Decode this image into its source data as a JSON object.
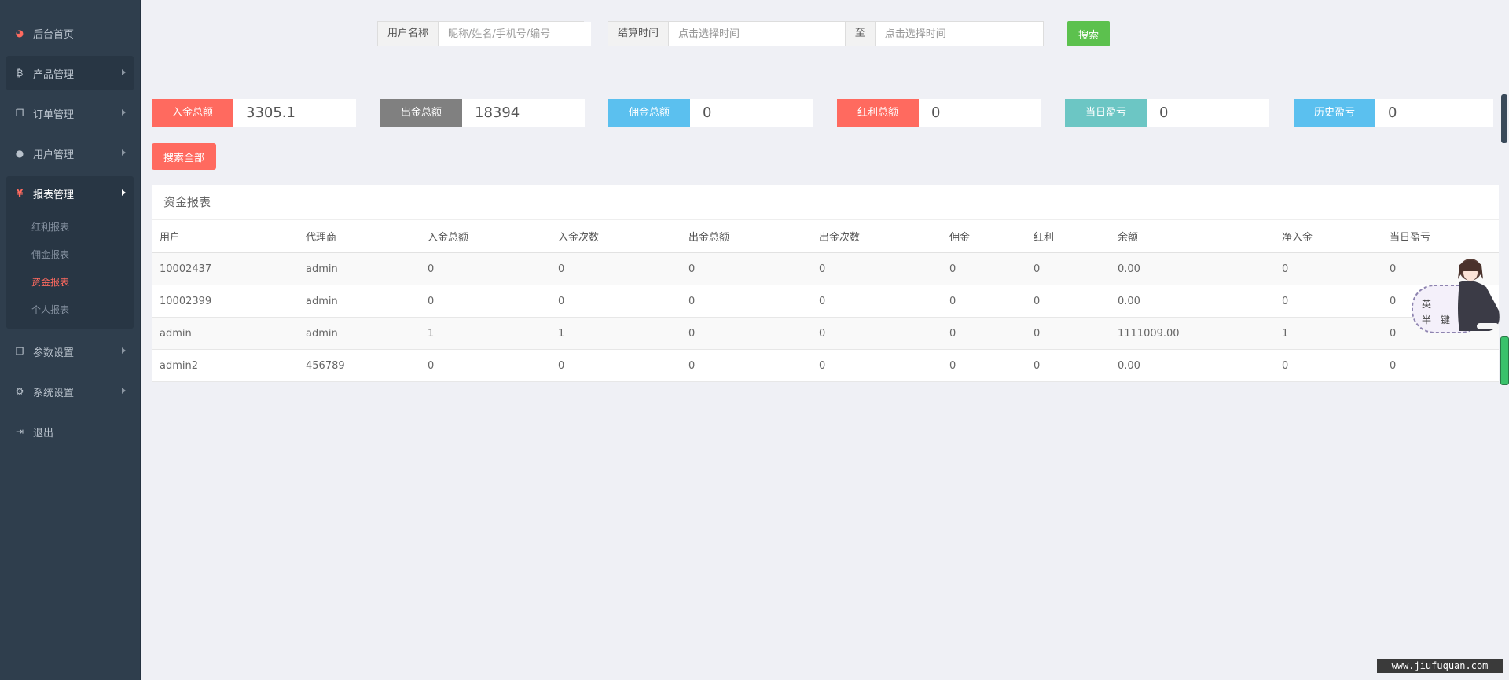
{
  "sidebar": {
    "items": [
      {
        "label": "后台首页",
        "icon": "dashboard-icon"
      },
      {
        "label": "产品管理",
        "icon": "bitcoin-icon"
      },
      {
        "label": "订单管理",
        "icon": "copy-icon"
      },
      {
        "label": "用户管理",
        "icon": "user-icon"
      },
      {
        "label": "报表管理",
        "icon": "yen-icon"
      },
      {
        "label": "参数设置",
        "icon": "copy-icon"
      },
      {
        "label": "系统设置",
        "icon": "gears-icon"
      },
      {
        "label": "退出",
        "icon": "sign-out-icon"
      }
    ],
    "report_sub": [
      "红利报表",
      "佣金报表",
      "资金报表",
      "个人报表"
    ],
    "current_sub": "资金报表"
  },
  "search": {
    "username_label": "用户名称",
    "username_placeholder": "昵称/姓名/手机号/编号",
    "time_label": "结算时间",
    "time_start_placeholder": "点击选择时间",
    "to_label": "至",
    "time_end_placeholder": "点击选择时间",
    "button": "搜索"
  },
  "stats": [
    {
      "label": "入金总额",
      "value": "3305.1",
      "color": "#ff6a5f"
    },
    {
      "label": "出金总额",
      "value": "18394",
      "color": "#808080"
    },
    {
      "label": "佣金总额",
      "value": "0",
      "color": "#5bc0ef"
    },
    {
      "label": "红利总额",
      "value": "0",
      "color": "#ff6a5f"
    },
    {
      "label": "当日盈亏",
      "value": "0",
      "color": "#6cc6c4"
    },
    {
      "label": "历史盈亏",
      "value": "0",
      "color": "#5bc0ef"
    }
  ],
  "search_all_button": "搜索全部",
  "table": {
    "title": "资金报表",
    "columns": [
      "用户",
      "代理商",
      "入金总额",
      "入金次数",
      "出金总额",
      "出金次数",
      "佣金",
      "红利",
      "余额",
      "净入金",
      "当日盈亏"
    ],
    "rows": [
      [
        "10002437",
        "admin",
        "0",
        "0",
        "0",
        "0",
        "0",
        "0",
        "0.00",
        "0",
        "0"
      ],
      [
        "10002399",
        "admin",
        "0",
        "0",
        "0",
        "0",
        "0",
        "0",
        "0.00",
        "0",
        "0"
      ],
      [
        "admin",
        "admin",
        "1",
        "1",
        "0",
        "0",
        "0",
        "0",
        "1111009.00",
        "1",
        "0"
      ],
      [
        "admin2",
        "456789",
        "0",
        "0",
        "0",
        "0",
        "0",
        "0",
        "0.00",
        "0",
        "0"
      ]
    ]
  },
  "mascot_text": [
    "英",
    "半",
    "键"
  ],
  "watermark": "www.jiufuquan.com"
}
